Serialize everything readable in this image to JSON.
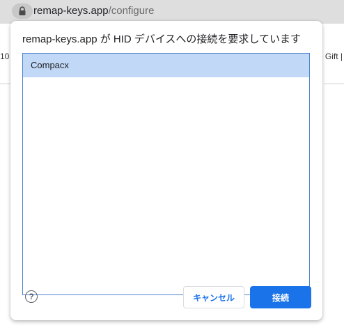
{
  "browser": {
    "url_domain": "remap-keys.app",
    "url_path": "/configure",
    "lock_icon": "lock-icon"
  },
  "background_page": {
    "left_fragment": "10",
    "right_fragment": "Gift |"
  },
  "dialog": {
    "title": "remap-keys.app が HID デバイスへの接続を要求しています",
    "devices": [
      {
        "label": "Compacx",
        "selected": true
      }
    ],
    "help_icon": "help-icon",
    "help_glyph": "?",
    "cancel_label": "キャンセル",
    "connect_label": "接続",
    "accent_color": "#1a73e8",
    "selection_color": "#c2d8f7"
  }
}
